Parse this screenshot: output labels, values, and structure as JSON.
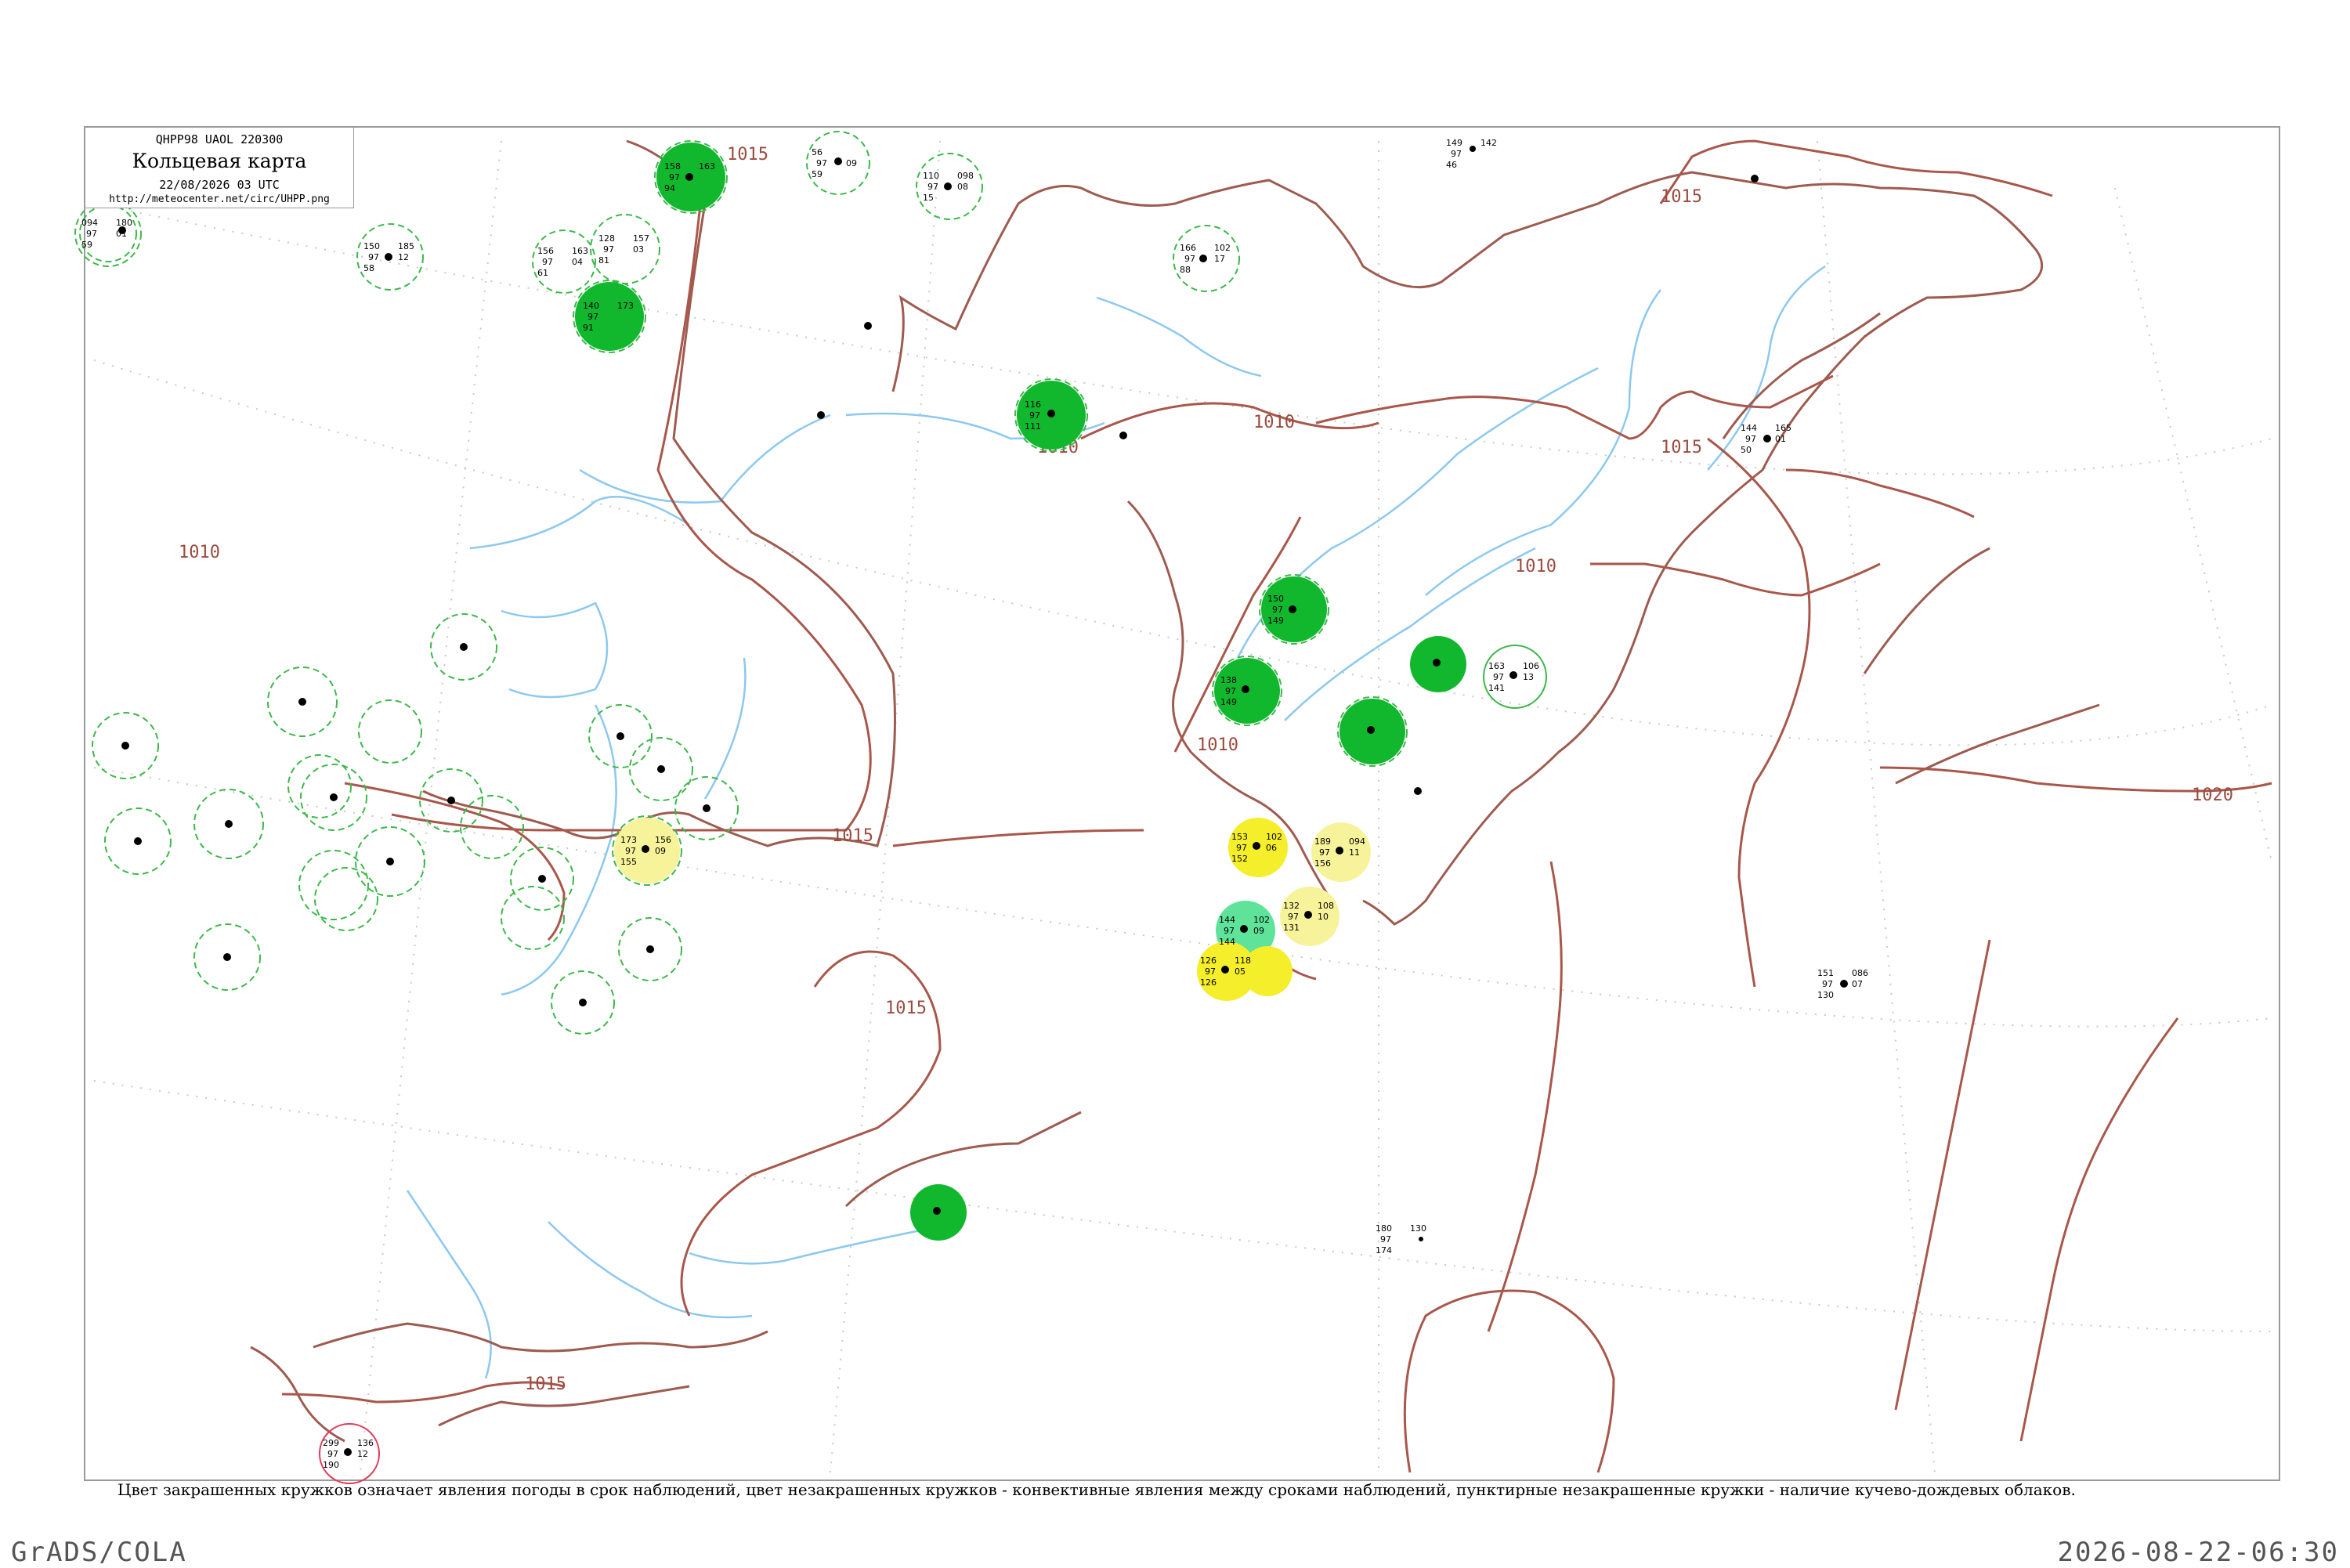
{
  "legend": {
    "code": "QHPP98  UAOL  220300",
    "title": "Кольцевая карта",
    "date": "22/08/2026 03 UTC",
    "url": "http://meteocenter.net/circ/UHPP.png"
  },
  "caption": "Цвет закрашенных кружков означает явления погоды в срок наблюдений, цвет незакрашенных кружков - конвективные явления между сроками наблюдений, пунктирные незакрашенные кружки - наличие кучево-дождевых облаков.",
  "footer": {
    "left": "GrADS/COLA",
    "right": "2026-08-22-06:30"
  },
  "isobar_labels": [
    "1015",
    "1010",
    "1015",
    "1010",
    "1010",
    "1015",
    "1015",
    "1015",
    "1010",
    "1020",
    "1015",
    "1010"
  ],
  "colors": {
    "isobar": "#a9574b",
    "coast": "#9e5b4f",
    "river": "#8cc8f0",
    "cb_dashed": "#3cb84a",
    "precip_green": "#11b82e",
    "drizzle_yellow": "#f5ee2a",
    "light_yellow": "#f7f39a",
    "mint": "#5fe39a",
    "storm_red": "#e03a5a",
    "frame": "#9a9a9a"
  },
  "stations": [
    {
      "id": "s1",
      "pressure": "094",
      "temp": "97",
      "dew": "59",
      "p2": "180",
      "tend": "01",
      "type": "cb",
      "name": ""
    },
    {
      "id": "s2",
      "pressure": "150",
      "temp": "97",
      "dew": "58",
      "p2": "185",
      "tend": "12",
      "type": "cb",
      "name": ""
    },
    {
      "id": "s3",
      "pressure": "156",
      "temp": "97",
      "dew": "61",
      "p2": "163",
      "tend": "04",
      "type": "cb",
      "name": ""
    },
    {
      "id": "s4",
      "pressure": "128",
      "temp": "97",
      "dew": "81",
      "p2": "157",
      "tend": "03",
      "type": "cb",
      "name": ""
    },
    {
      "id": "s5",
      "pressure": "140",
      "temp": "97",
      "dew": "91",
      "p2": "173",
      "tend": "",
      "type": "green",
      "name": ""
    },
    {
      "id": "s6",
      "pressure": "158",
      "temp": "97",
      "dew": "94",
      "p2": "163",
      "tend": "",
      "type": "green",
      "name": ""
    },
    {
      "id": "s7",
      "pressure": "56",
      "temp": "97",
      "dew": "59",
      "p2": "",
      "tend": "09",
      "type": "cb",
      "name": ""
    },
    {
      "id": "s8",
      "pressure": "110",
      "temp": "97",
      "dew": "15",
      "p2": "098",
      "tend": "08",
      "type": "cb",
      "name": ""
    },
    {
      "id": "s9",
      "pressure": "166",
      "temp": "97",
      "dew": "88",
      "p2": "102",
      "tend": "17",
      "type": "cb",
      "name": ""
    },
    {
      "id": "s10",
      "pressure": "116",
      "temp": "97",
      "dew": "111",
      "p2": "",
      "tend": "",
      "type": "green",
      "name": ""
    },
    {
      "id": "s11",
      "pressure": "150",
      "temp": "97",
      "dew": "149",
      "p2": "",
      "tend": "",
      "type": "green",
      "name": ""
    },
    {
      "id": "s12",
      "pressure": "138",
      "temp": "97",
      "dew": "149",
      "p2": "",
      "tend": "",
      "type": "green",
      "name": ""
    },
    {
      "id": "s13",
      "pressure": "163",
      "temp": "97",
      "dew": "141",
      "p2": "106",
      "tend": "13",
      "type": "outline",
      "name": ""
    },
    {
      "id": "s14",
      "pressure": "153",
      "temp": "97",
      "dew": "152",
      "p2": "102",
      "tend": "06",
      "type": "yellow",
      "name": ""
    },
    {
      "id": "s15",
      "pressure": "189",
      "temp": "97",
      "dew": "156",
      "p2": "094",
      "tend": "11",
      "type": "lightyellow",
      "name": ""
    },
    {
      "id": "s16",
      "pressure": "132",
      "temp": "97",
      "dew": "131",
      "p2": "108",
      "tend": "10",
      "type": "lightyellow",
      "name": ""
    },
    {
      "id": "s17",
      "pressure": "144",
      "temp": "97",
      "dew": "144",
      "p2": "102",
      "tend": "09",
      "type": "mint",
      "name": ""
    },
    {
      "id": "s18",
      "pressure": "126",
      "temp": "97",
      "dew": "126",
      "p2": "118",
      "tend": "05",
      "type": "yellow",
      "name": ""
    },
    {
      "id": "s19",
      "pressure": "173",
      "temp": "97",
      "dew": "155",
      "p2": "156",
      "tend": "09",
      "type": "lightyellow",
      "name": ""
    },
    {
      "id": "s20",
      "pressure": "299",
      "temp": "97",
      "dew": "190",
      "p2": "136",
      "tend": "12",
      "type": "red",
      "name": ""
    },
    {
      "id": "s21",
      "pressure": "151",
      "temp": "97",
      "dew": "130",
      "p2": "086",
      "tend": "07",
      "type": "plain",
      "name": ""
    },
    {
      "id": "s22",
      "pressure": "180",
      "temp": "97",
      "dew": "174",
      "p2": "130",
      "tend": "",
      "type": "plain",
      "name": ""
    },
    {
      "id": "s23",
      "pressure": "149",
      "temp": "97",
      "dew": "46",
      "p2": "142",
      "tend": "",
      "type": "plain",
      "name": ""
    },
    {
      "id": "s24",
      "pressure": "144",
      "temp": "97",
      "dew": "50",
      "p2": "165",
      "tend": "01",
      "type": "plain",
      "name": ""
    }
  ]
}
